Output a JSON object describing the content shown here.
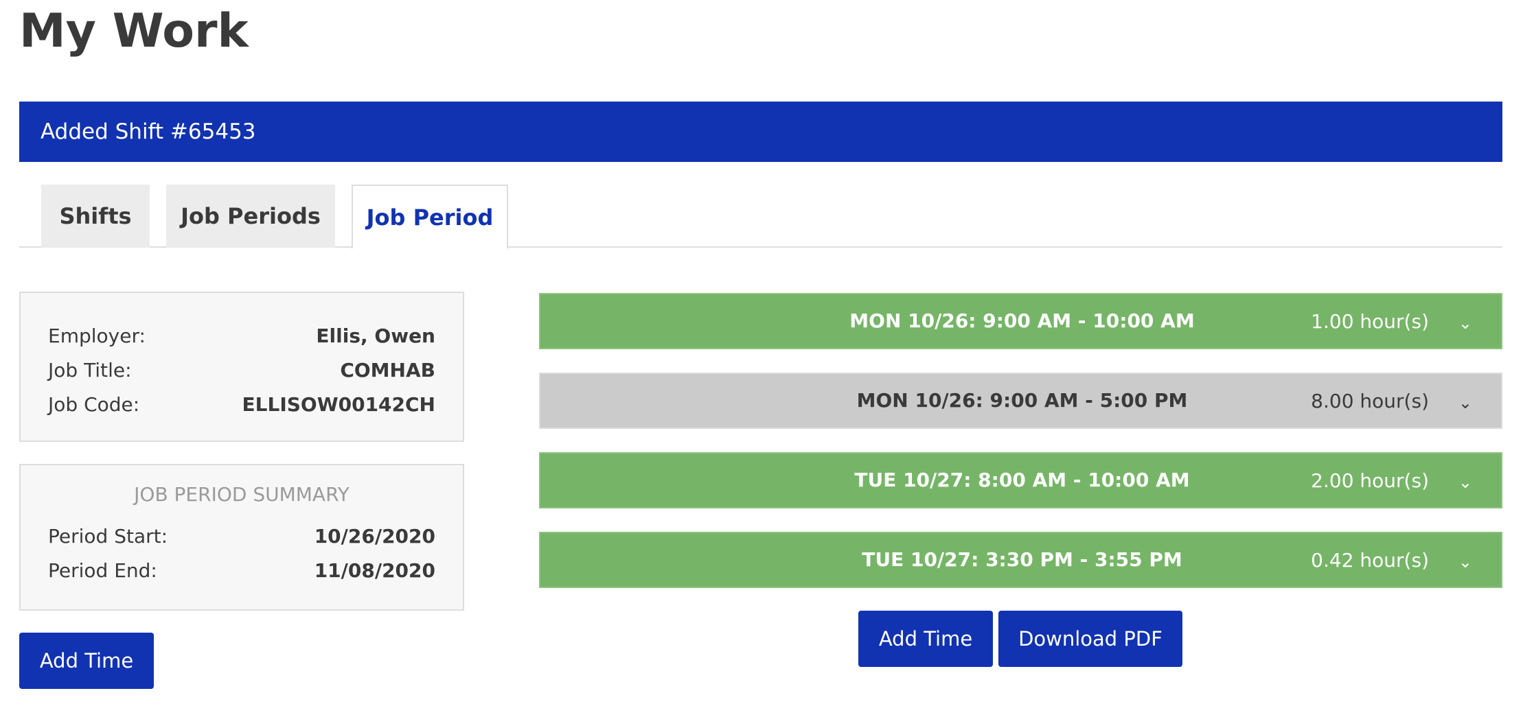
{
  "page": {
    "title": "My Work"
  },
  "alert": {
    "message": "Added Shift #65453"
  },
  "tabs": [
    {
      "label": "Shifts",
      "active": false
    },
    {
      "label": "Job Periods",
      "active": false
    },
    {
      "label": "Job Period",
      "active": true
    }
  ],
  "employer_info": {
    "employer_label": "Employer:",
    "employer_value": "Ellis, Owen",
    "job_title_label": "Job Title:",
    "job_title_value": "COMHAB",
    "job_code_label": "Job Code:",
    "job_code_value": "ELLISOW00142CH"
  },
  "summary": {
    "title": "JOB PERIOD SUMMARY",
    "period_start_label": "Period Start:",
    "period_start_value": "10/26/2020",
    "period_end_label": "Period End:",
    "period_end_value": "11/08/2020"
  },
  "left_actions": {
    "add_time_label": "Add Time"
  },
  "time_entries": [
    {
      "range": "MON 10/26: 9:00 AM - 10:00 AM",
      "hours": "1.00 hour(s)",
      "status": "approved",
      "status_color": "#76b567"
    },
    {
      "range": "MON 10/26: 9:00 AM - 5:00 PM",
      "hours": "8.00 hour(s)",
      "status": "pending",
      "status_color": "#cbcbcb"
    },
    {
      "range": "TUE 10/27: 8:00 AM - 10:00 AM",
      "hours": "2.00 hour(s)",
      "status": "approved",
      "status_color": "#76b567"
    },
    {
      "range": "TUE 10/27: 3:30 PM - 3:55 PM",
      "hours": "0.42 hour(s)",
      "status": "approved",
      "status_color": "#76b567"
    }
  ],
  "right_actions": {
    "add_time_label": "Add Time",
    "download_pdf_label": "Download PDF"
  },
  "icons": {
    "expand": "chevron-down-icon",
    "expand_glyph": "⌄"
  },
  "colors": {
    "brand_blue": "#1133b1",
    "approved_green": "#76b567",
    "pending_gray": "#cbcbcb"
  }
}
